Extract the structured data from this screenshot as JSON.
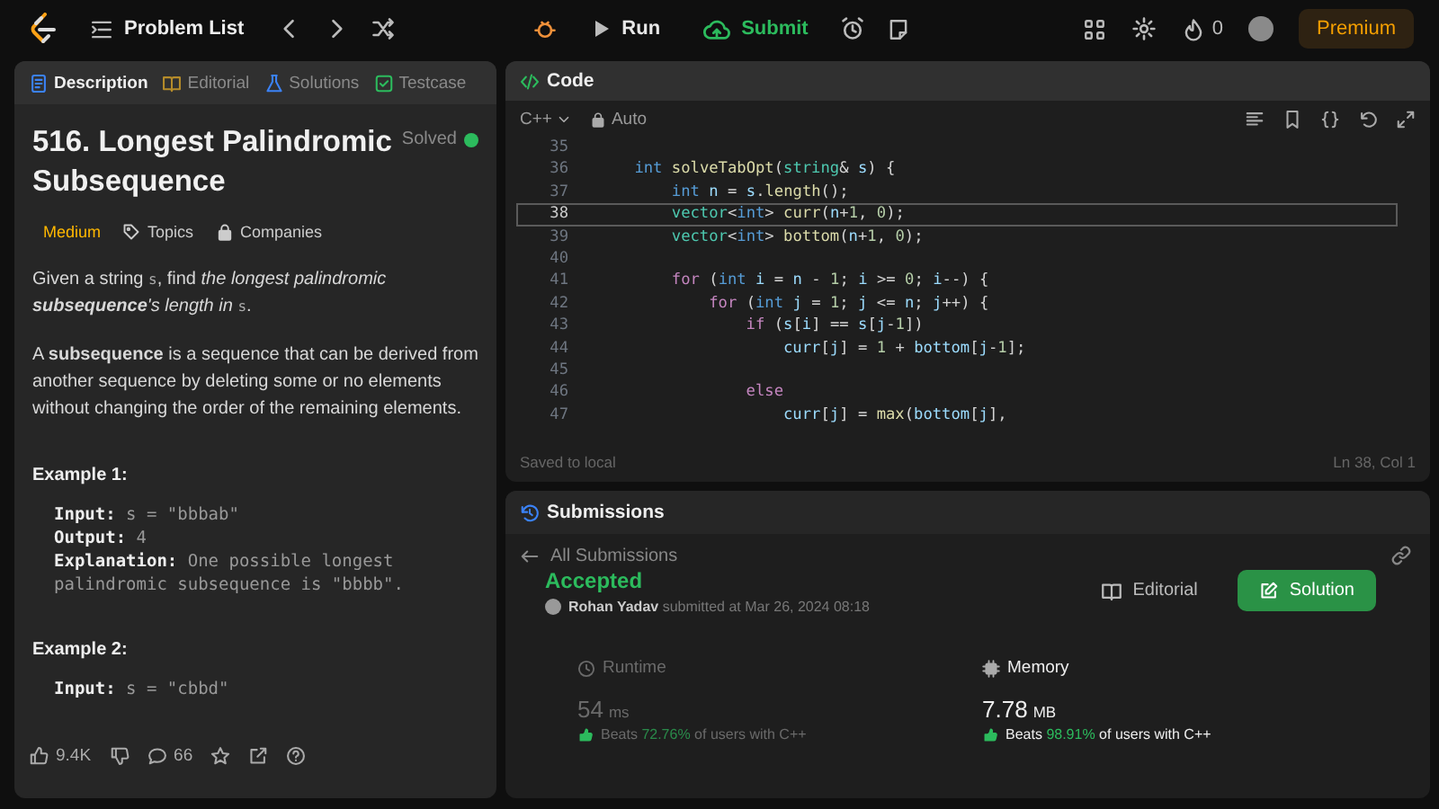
{
  "topbar": {
    "nav_title": "Problem List",
    "run": "Run",
    "submit": "Submit",
    "streak": "0",
    "premium": "Premium"
  },
  "description_panel": {
    "tabs": [
      {
        "label": "Description",
        "selected": true,
        "kind": "doc"
      },
      {
        "label": "Editorial",
        "selected": false,
        "kind": "book"
      },
      {
        "label": "Solutions",
        "selected": false,
        "kind": "flask"
      },
      {
        "label": "Testcase",
        "selected": false,
        "kind": "check"
      }
    ],
    "title": "516. Longest Palindromic Subsequence",
    "status": "Solved",
    "difficulty": "Medium",
    "topics": "Topics",
    "companies": "Companies",
    "paragraphs": [
      [
        {
          "kind": "plain",
          "text": "Given a string "
        },
        {
          "kind": "code",
          "text": "s"
        },
        {
          "kind": "plain",
          "text": ", find "
        },
        {
          "kind": "italic",
          "text": "the longest palindromic "
        },
        {
          "kind": "bolditalic",
          "text": "subsequence"
        },
        {
          "kind": "italic",
          "text": "'s length in "
        },
        {
          "kind": "code",
          "text": "s"
        },
        {
          "kind": "plain",
          "text": "."
        }
      ],
      [
        {
          "kind": "plain",
          "text": "A "
        },
        {
          "kind": "bold",
          "text": "subsequence"
        },
        {
          "kind": "plain",
          "text": " is a sequence that can be derived from another sequence by deleting some or no elements without changing the order of the remaining elements."
        }
      ]
    ],
    "examples": [
      {
        "heading": "Example 1:",
        "lines": [
          {
            "label": "Input:",
            "value": "s = \"bbbab\""
          },
          {
            "label": "Output:",
            "value": "4"
          },
          {
            "label": "Explanation:",
            "value": "One possible longest palindromic subsequence is \"bbbb\"."
          }
        ]
      },
      {
        "heading": "Example 2:",
        "lines": [
          {
            "label": "Input:",
            "value": "s = \"cbbd\""
          }
        ]
      }
    ],
    "footer": {
      "likes": "9.4K",
      "comments": "66"
    }
  },
  "code_panel": {
    "title": "Code",
    "language": "C++",
    "mode": "Auto",
    "lines": [
      {
        "number": "35",
        "current": false
      },
      {
        "number": "36",
        "code": "    int solveTabOpt(string& s) {",
        "current": false
      },
      {
        "number": "37",
        "code": "        int n = s.length();",
        "current": false
      },
      {
        "number": "38",
        "code": "        vector<int> curr(n+1, 0);",
        "current": true
      },
      {
        "number": "39",
        "code": "        vector<int> bottom(n+1, 0);",
        "current": false
      },
      {
        "number": "40",
        "current": false
      },
      {
        "number": "41",
        "code": "        for (int i = n - 1; i >= 0; i--) {",
        "current": false
      },
      {
        "number": "42",
        "code": "            for (int j = 1; j <= n; j++) {",
        "current": false
      },
      {
        "number": "43",
        "code": "                if (s[i] == s[j-1])",
        "current": false
      },
      {
        "number": "44",
        "code": "                    curr[j] = 1 + bottom[j-1];",
        "current": false
      },
      {
        "number": "45",
        "current": false
      },
      {
        "number": "46",
        "code": "                else",
        "current": false
      },
      {
        "number": "47",
        "code": "                    curr[j] = max(bottom[j],",
        "current": false
      }
    ],
    "save_status": "Saved to local",
    "cursor": "Ln 38, Col 1"
  },
  "submissions": {
    "title": "Submissions",
    "back": "All Submissions",
    "result": "Accepted",
    "user": "Rohan Yadav",
    "submitted": "submitted at Mar 26, 2024 08:18",
    "editorial": "Editorial",
    "solution": "Solution",
    "metrics": [
      {
        "kind": "clock",
        "label": "Runtime",
        "value": "54",
        "unit": "ms",
        "beats": "Beats",
        "percent": "72.76%",
        "suffix": "of users with C++",
        "selected": false
      },
      {
        "kind": "chip",
        "label": "Memory",
        "value": "7.78",
        "unit": "MB",
        "beats": "Beats",
        "percent": "98.91%",
        "suffix": "of users with C++",
        "selected": true
      }
    ]
  }
}
